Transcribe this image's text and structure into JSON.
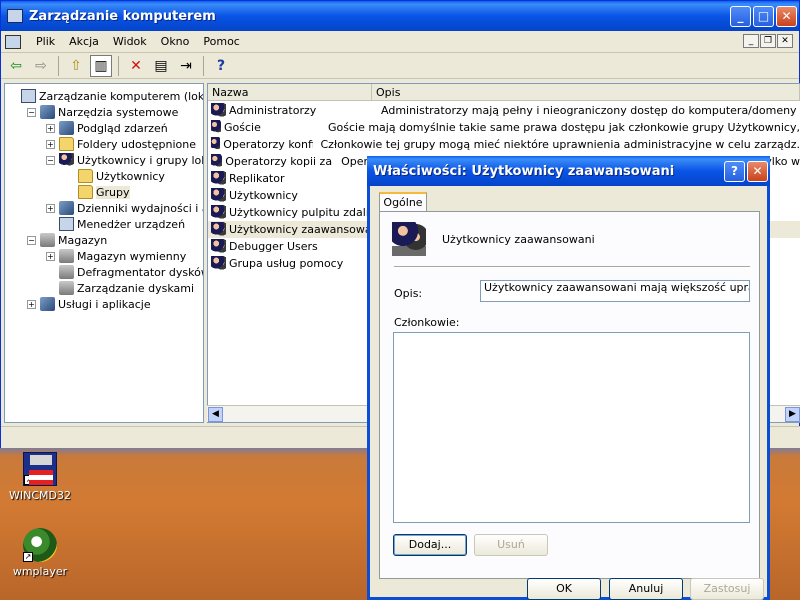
{
  "main_window": {
    "title": "Zarządzanie komputerem",
    "menu": [
      "Plik",
      "Akcja",
      "Widok",
      "Okno",
      "Pomoc"
    ]
  },
  "toolbar": {
    "icons": [
      "back-arrow-icon",
      "forward-arrow-icon",
      "up-folder-icon",
      "show-hide-tree-icon",
      "delete-icon",
      "properties-icon",
      "export-list-icon",
      "help-icon"
    ]
  },
  "tree": {
    "items": [
      {
        "label": "Zarządzanie komputerem (lokalne)",
        "level": 0,
        "expander": "",
        "icon": "computer-icon"
      },
      {
        "label": "Narzędzia systemowe",
        "level": 1,
        "expander": "−",
        "icon": "tools-icon"
      },
      {
        "label": "Podgląd zdarzeń",
        "level": 2,
        "expander": "+",
        "icon": "event-viewer-icon"
      },
      {
        "label": "Foldery udostępnione",
        "level": 2,
        "expander": "+",
        "icon": "shared-folder-icon"
      },
      {
        "label": "Użytkownicy i grupy lokalne",
        "level": 2,
        "expander": "−",
        "icon": "users-icon"
      },
      {
        "label": "Użytkownicy",
        "level": 3,
        "expander": "",
        "icon": "folder-icon"
      },
      {
        "label": "Grupy",
        "level": 3,
        "expander": "",
        "icon": "folder-open-icon"
      },
      {
        "label": "Dzienniki wydajności i alerty",
        "level": 2,
        "expander": "+",
        "icon": "performance-icon"
      },
      {
        "label": "Menedżer urządzeń",
        "level": 2,
        "expander": "",
        "icon": "device-manager-icon"
      },
      {
        "label": "Magazyn",
        "level": 1,
        "expander": "−",
        "icon": "storage-icon"
      },
      {
        "label": "Magazyn wymienny",
        "level": 2,
        "expander": "+",
        "icon": "removable-storage-icon"
      },
      {
        "label": "Defragmentator dysków",
        "level": 2,
        "expander": "",
        "icon": "defrag-icon"
      },
      {
        "label": "Zarządzanie dyskami",
        "level": 2,
        "expander": "",
        "icon": "disk-management-icon"
      },
      {
        "label": "Usługi i aplikacje",
        "level": 1,
        "expander": "+",
        "icon": "services-icon"
      }
    ]
  },
  "list": {
    "columns": [
      "Nazwa",
      "Opis"
    ],
    "rows": [
      {
        "name": "Administratorzy",
        "desc": "Administratorzy mają pełny i nieograniczony dostęp do komputera/domeny"
      },
      {
        "name": "Goście",
        "desc": "Goście mają domyślnie takie same prawa dostępu jak członkowie grupy Użytkownicy,"
      },
      {
        "name": "Operatorzy konfiguracji sieci",
        "desc": "Członkowie tej grupy mogą mieć niektóre uprawnienia administracyjne w celu zarządz."
      },
      {
        "name": "Operatorzy kopii zapasowych",
        "desc": "Operatorzy kopii zapasowych mogą zastępować ograniczenia zabezpieczeń tylko w"
      },
      {
        "name": "Replikator",
        "desc": ""
      },
      {
        "name": "Użytkownicy",
        "desc": ""
      },
      {
        "name": "Użytkownicy pulpitu zdalnego",
        "desc": ""
      },
      {
        "name": "Użytkownicy zaawansowani",
        "desc": "mi."
      },
      {
        "name": "Debugger Users",
        "desc": ""
      },
      {
        "name": "Grupa usług pomocy",
        "desc": ""
      }
    ]
  },
  "dialog": {
    "title": "Właściwości: Użytkownicy zaawansowani",
    "tab": "Ogólne",
    "group_name": "Użytkownicy zaawansowani",
    "description_label": "Opis:",
    "description_value": "Użytkownicy zaawansowani mają większość uprawnień",
    "members_label": "Członkowie:",
    "add_button": "Dodaj...",
    "remove_button": "Usuń",
    "ok_button": "OK",
    "cancel_button": "Anuluj",
    "apply_button": "Zastosuj"
  },
  "desktop": {
    "icons": [
      {
        "label": "WINCMD32",
        "icon": "floppy-disk-icon"
      },
      {
        "label": "wmplayer",
        "icon": "media-player-icon"
      }
    ]
  }
}
